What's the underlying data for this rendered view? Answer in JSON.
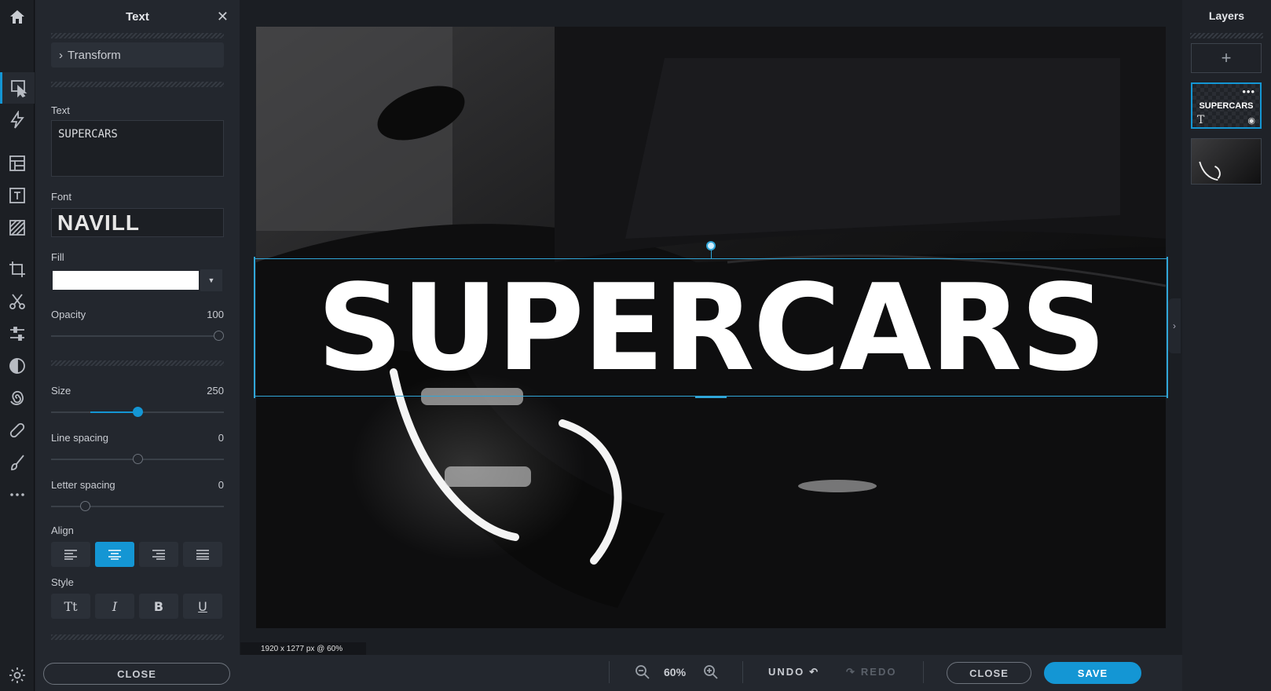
{
  "panel": {
    "title": "Text",
    "transform_label": "Transform",
    "text_label": "Text",
    "text_value": "SUPERCARS",
    "font_label": "Font",
    "font_value": "NAVILL",
    "fill_label": "Fill",
    "fill_color": "#ffffff",
    "opacity_label": "Opacity",
    "opacity_value": "100",
    "size_label": "Size",
    "size_value": "250",
    "line_spacing_label": "Line spacing",
    "line_spacing_value": "0",
    "letter_spacing_label": "Letter spacing",
    "letter_spacing_value": "0",
    "align_label": "Align",
    "align_selected": "center",
    "style_label": "Style",
    "style_buttons": [
      "Tt",
      "I",
      "B",
      "U"
    ],
    "close_label": "CLOSE"
  },
  "sliders": {
    "opacity_fraction": 1.0,
    "size_fraction": 0.5,
    "line_spacing_fraction": 0.5,
    "letter_spacing_fraction": 0.18
  },
  "canvas": {
    "overlay_text": "SUPERCARS",
    "dimensions_label": "1920 x 1277 px @ 60%"
  },
  "bottombar": {
    "zoom_value": "60%",
    "undo_label": "UNDO",
    "redo_label": "REDO",
    "close_label": "CLOSE",
    "save_label": "SAVE"
  },
  "layers": {
    "title": "Layers",
    "add_label": "+",
    "text_layer_label": "SUPERCARS"
  },
  "colors": {
    "accent": "#1496d4"
  }
}
